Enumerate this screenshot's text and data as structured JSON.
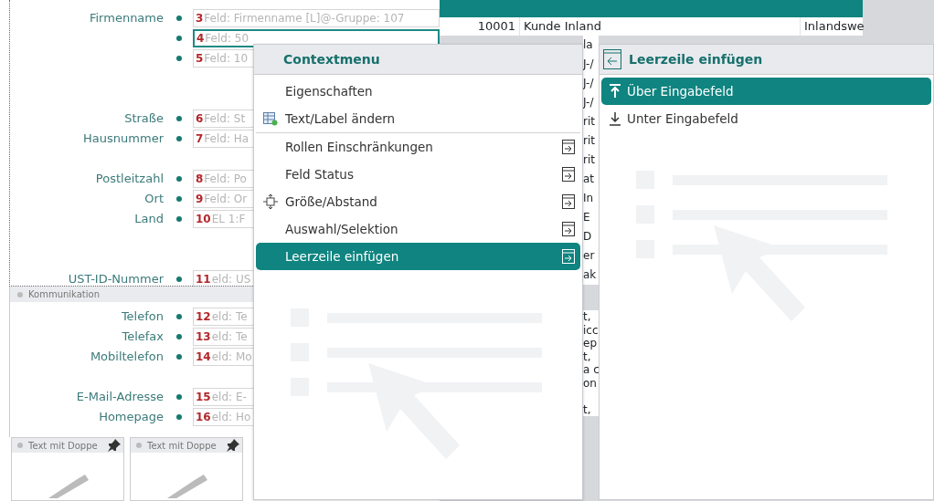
{
  "form": {
    "rows": [
      {
        "kind": "field",
        "label": "Firmenname",
        "number": "3",
        "text": "Feld: Firmenname  [L]@-Gruppe: 107",
        "selected": false
      },
      {
        "kind": "field",
        "number": "4",
        "text": "Feld: 50",
        "selected": true
      },
      {
        "kind": "field",
        "number": "5",
        "text": "Feld: 10",
        "selected": false
      },
      {
        "kind": "blank"
      },
      {
        "kind": "blank"
      },
      {
        "kind": "field",
        "label": "Straße",
        "number": "6",
        "text": "Feld: St",
        "selected": false
      },
      {
        "kind": "field",
        "label": "Hausnummer",
        "number": "7",
        "text": "Feld: Ha",
        "selected": false
      },
      {
        "kind": "blank"
      },
      {
        "kind": "field",
        "label": "Postleitzahl",
        "number": "8",
        "text": "Feld: Po",
        "selected": false
      },
      {
        "kind": "field",
        "label": "Ort",
        "number": "9",
        "text": "Feld: Or",
        "selected": false
      },
      {
        "kind": "field",
        "label": "Land",
        "number": "10",
        "text": "EL  1:F",
        "selected": false
      },
      {
        "kind": "blank"
      },
      {
        "kind": "blank"
      },
      {
        "kind": "field",
        "label": "UST-ID-Nummer",
        "number": "11",
        "text": "eld: US",
        "selected": false
      }
    ]
  },
  "kommunikation": {
    "title": "Kommunikation",
    "rows": [
      {
        "kind": "field",
        "label": "Telefon",
        "number": "12",
        "text": "eld: Te",
        "selected": false
      },
      {
        "kind": "field",
        "label": "Telefax",
        "number": "13",
        "text": "eld: Te",
        "selected": false
      },
      {
        "kind": "field",
        "label": "Mobiltelefon",
        "number": "14",
        "text": "eld: Mo",
        "selected": false
      },
      {
        "kind": "blank"
      },
      {
        "kind": "field",
        "label": "E-Mail-Adresse",
        "number": "15",
        "text": "eld: E-",
        "selected": false
      },
      {
        "kind": "field",
        "label": "Homepage",
        "number": "16",
        "text": "eld: Ho",
        "selected": false
      }
    ]
  },
  "panels": [
    {
      "title": "Text mit Doppe"
    },
    {
      "title": "Text mit Doppe"
    }
  ],
  "table": {
    "row": {
      "number": "10001",
      "name": "Kunde Inland",
      "type": "Inlandswe"
    },
    "fragments_upper": [
      "la",
      "J-/",
      "J-/",
      "J-/",
      "rit",
      "rit",
      "rit",
      "at",
      "In",
      "E",
      "D",
      "er",
      "ak"
    ],
    "fragments_lower": [
      "t,",
      "icc",
      "ep",
      "t,",
      "a c",
      "on",
      "t,"
    ]
  },
  "context_menu": {
    "title": "Contextmenu",
    "items": [
      {
        "label": "Eigenschaften",
        "submenu": false,
        "selected": false,
        "separator_after": false
      },
      {
        "label": "Text/Label ändern",
        "submenu": false,
        "selected": false,
        "separator_after": true
      },
      {
        "label": "Rollen Einschränkungen",
        "submenu": true,
        "selected": false,
        "separator_after": false
      },
      {
        "label": "Feld Status",
        "submenu": true,
        "selected": false,
        "separator_after": false
      },
      {
        "label": "Größe/Abstand",
        "submenu": true,
        "selected": false,
        "separator_after": false
      },
      {
        "label": "Auswahl/Selektion",
        "submenu": true,
        "selected": false,
        "separator_after": false
      },
      {
        "label": "Leerzeile einfügen",
        "submenu": true,
        "selected": true,
        "separator_after": false
      }
    ]
  },
  "submenu": {
    "title": "Leerzeile einfügen",
    "items": [
      {
        "label": "Über Eingabefeld",
        "selected": true
      },
      {
        "label": "Unter Eingabefeld",
        "selected": false
      }
    ]
  }
}
